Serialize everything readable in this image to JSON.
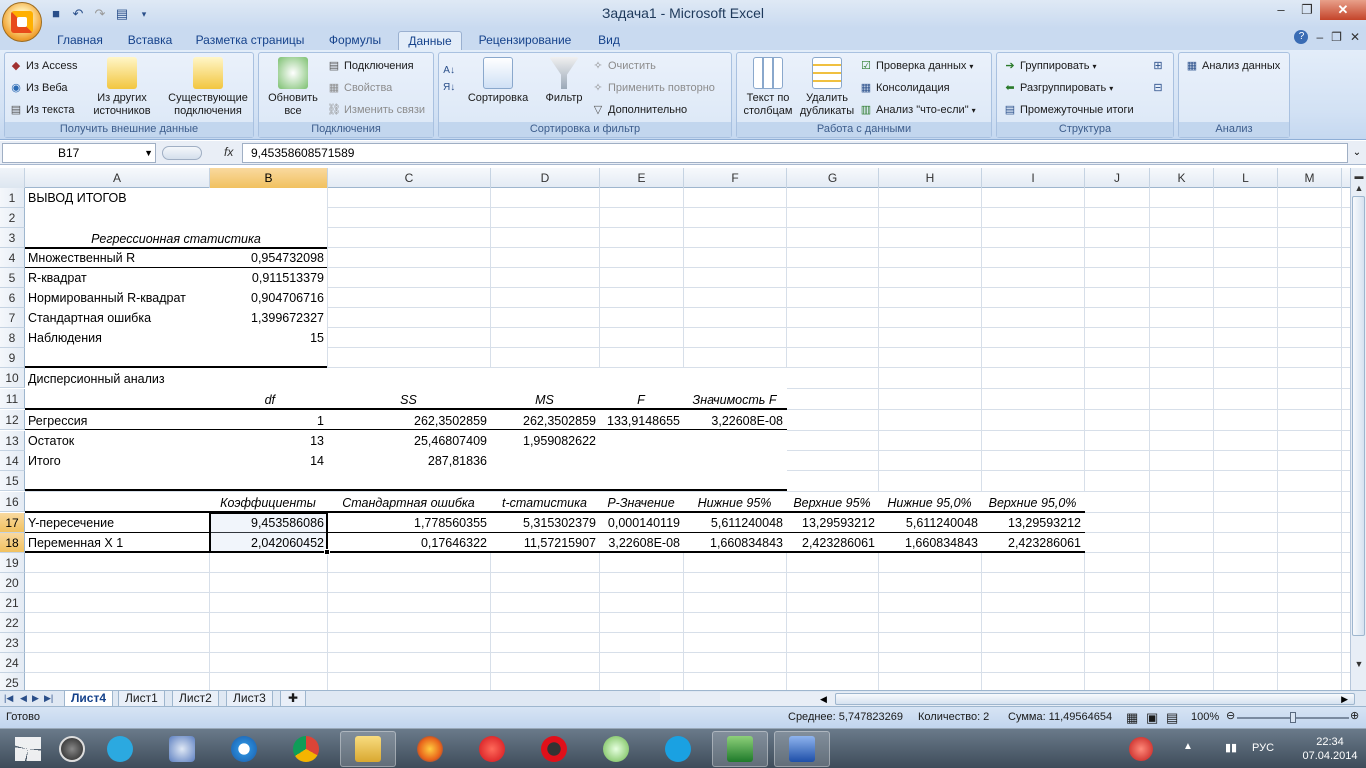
{
  "window": {
    "title": "Задача1 - Microsoft Excel"
  },
  "qat": {
    "icons": [
      "save-icon",
      "undo-icon",
      "redo-icon",
      "print-preview-icon"
    ]
  },
  "tabs": [
    "Главная",
    "Вставка",
    "Разметка страницы",
    "Формулы",
    "Данные",
    "Рецензирование",
    "Вид"
  ],
  "active_tab": "Данные",
  "ribbon": {
    "get_external": {
      "label": "Получить внешние данные",
      "from_access": "Из Access",
      "from_web": "Из Веба",
      "from_text": "Из текста",
      "from_other": "Из других источников",
      "existing": "Существующие подключения"
    },
    "connections": {
      "label": "Подключения",
      "refresh_all": "Обновить все",
      "connections": "Подключения",
      "properties": "Свойства",
      "edit_links": "Изменить связи"
    },
    "sort_filter": {
      "label": "Сортировка и фильтр",
      "sort": "Сортировка",
      "filter": "Фильтр",
      "clear": "Очистить",
      "reapply": "Применить повторно",
      "advanced": "Дополнительно"
    },
    "data_tools": {
      "label": "Работа с данными",
      "text_to_columns": "Текст по столбцам",
      "remove_duplicates": "Удалить дубликаты",
      "validation": "Проверка данных",
      "consolidate": "Консолидация",
      "whatif": "Анализ \"что-если\""
    },
    "outline": {
      "label": "Структура",
      "group": "Группировать",
      "ungroup": "Разгруппировать",
      "subtotal": "Промежуточные итоги"
    },
    "analysis": {
      "label": "Анализ",
      "data_analysis": "Анализ данных"
    }
  },
  "formula_bar": {
    "name_box": "B17",
    "fx": "fx",
    "value": "9,45358608571589"
  },
  "columns": [
    "A",
    "B",
    "C",
    "D",
    "E",
    "F",
    "G",
    "H",
    "I",
    "J",
    "K",
    "L",
    "M"
  ],
  "selected_column": "B",
  "rows": [
    "1",
    "2",
    "3",
    "4",
    "5",
    "6",
    "7",
    "8",
    "9",
    "10",
    "11",
    "12",
    "13",
    "14",
    "15",
    "16",
    "17",
    "18",
    "19",
    "20",
    "21",
    "22",
    "23",
    "24",
    "25"
  ],
  "selected_rows": [
    "17",
    "18"
  ],
  "cells": {
    "r1": {
      "a": "ВЫВОД ИТОГОВ"
    },
    "r3": {
      "a": "Регрессионная статистика"
    },
    "r4": {
      "a": "Множественный R",
      "b": "0,954732098"
    },
    "r5": {
      "a": "R-квадрат",
      "b": "0,911513379"
    },
    "r6": {
      "a": "Нормированный R-квадрат",
      "b": "0,904706716"
    },
    "r7": {
      "a": "Стандартная ошибка",
      "b": "1,399672327"
    },
    "r8": {
      "a": "Наблюдения",
      "b": "15"
    },
    "r10": {
      "a": "Дисперсионный анализ"
    },
    "r11": {
      "b": "df",
      "c": "SS",
      "d": "MS",
      "e": "F",
      "f": "Значимость F"
    },
    "r12": {
      "a": "Регрессия",
      "b": "1",
      "c": "262,3502859",
      "d": "262,3502859",
      "e": "133,9148655",
      "f": "3,22608E-08"
    },
    "r13": {
      "a": "Остаток",
      "b": "13",
      "c": "25,46807409",
      "d": "1,959082622"
    },
    "r14": {
      "a": "Итого",
      "b": "14",
      "c": "287,81836"
    },
    "r16": {
      "b": "Коэффициенты",
      "c": "Стандартная ошибка",
      "d": "t-статистика",
      "e": "P-Значение",
      "f": "Нижние 95%",
      "g": "Верхние 95%",
      "h": "Нижние 95,0%",
      "i": "Верхние 95,0%"
    },
    "r17": {
      "a": "Y-пересечение",
      "b": "9,453586086",
      "c": "1,778560355",
      "d": "5,315302379",
      "e": "0,000140119",
      "f": "5,611240048",
      "g": "13,29593212",
      "h": "5,611240048",
      "i": "13,29593212"
    },
    "r18": {
      "a": "Переменная X 1",
      "b": "2,042060452",
      "c": "0,17646322",
      "d": "11,57215907",
      "e": "3,22608E-08",
      "f": "1,660834843",
      "g": "2,423286061",
      "h": "1,660834843",
      "i": "2,423286061"
    }
  },
  "sheets": [
    "Лист4",
    "Лист1",
    "Лист2",
    "Лист3"
  ],
  "active_sheet": "Лист4",
  "status": {
    "ready": "Готово",
    "average": "Среднее: 5,747823269",
    "count": "Количество: 2",
    "sum": "Сумма: 11,49564654",
    "zoom": "100%"
  },
  "taskbar": {
    "apps": [
      "start-button",
      "media-center-icon",
      "twitter-icon",
      "speaker-icon",
      "ie-icon",
      "chrome-icon",
      "explorer-icon",
      "firefox-icon",
      "yandex-icon",
      "opera-icon",
      "utorrent-icon",
      "skype-icon",
      "excel-icon",
      "word-icon"
    ],
    "lang": "РУС",
    "time": "22:34",
    "date": "07.04.2014"
  },
  "colors": {
    "accent": "#15428b",
    "selection_header": "#f1c15f",
    "ribbon_bg": "#dbe7f6"
  }
}
